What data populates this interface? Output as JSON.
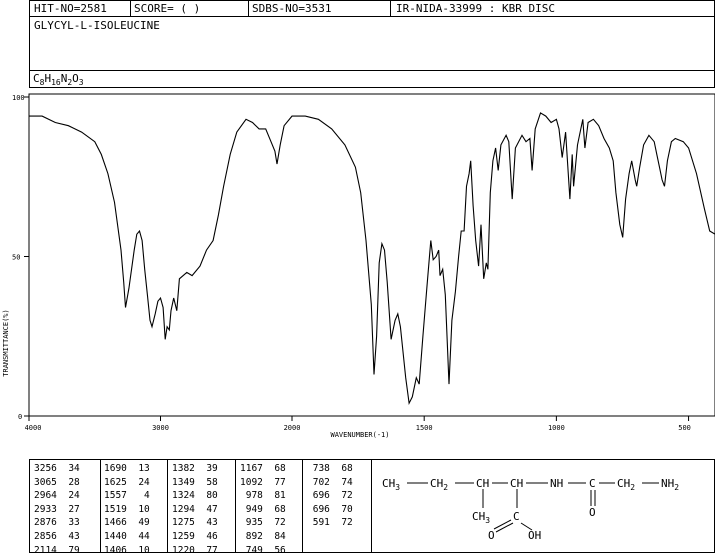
{
  "header": {
    "hit_no": "HIT-NO=2581",
    "score": "SCORE=  (   )",
    "sdbs_no": "SDBS-NO=3531",
    "ir_info": "IR-NIDA-33999 : KBR DISC"
  },
  "compound_name": "GLYCYL-L-ISOLEUCINE",
  "formula": "C8H16N2O3",
  "chart_data": {
    "type": "line",
    "xlabel": "WAVENUMBER(-1)",
    "ylabel": "TRANSMITTANCE(%)",
    "x_ticks": [
      4000,
      3000,
      2000,
      1500,
      1000,
      500
    ],
    "y_ticks": [
      0,
      50,
      100
    ],
    "xlim": [
      4000,
      400
    ],
    "ylim": [
      0,
      100
    ],
    "series": [
      {
        "points": [
          [
            4000,
            94
          ],
          [
            3900,
            94
          ],
          [
            3800,
            92
          ],
          [
            3700,
            91
          ],
          [
            3600,
            89
          ],
          [
            3500,
            86
          ],
          [
            3450,
            82
          ],
          [
            3400,
            76
          ],
          [
            3350,
            67
          ],
          [
            3300,
            52
          ],
          [
            3280,
            42
          ],
          [
            3266,
            34
          ],
          [
            3240,
            40
          ],
          [
            3200,
            52
          ],
          [
            3180,
            57
          ],
          [
            3160,
            58
          ],
          [
            3140,
            55
          ],
          [
            3120,
            46
          ],
          [
            3100,
            38
          ],
          [
            3080,
            30
          ],
          [
            3065,
            28
          ],
          [
            3040,
            32
          ],
          [
            3020,
            36
          ],
          [
            3000,
            37
          ],
          [
            2980,
            34
          ],
          [
            2964,
            24
          ],
          [
            2950,
            28
          ],
          [
            2933,
            27
          ],
          [
            2920,
            33
          ],
          [
            2900,
            37
          ],
          [
            2876,
            33
          ],
          [
            2856,
            43
          ],
          [
            2800,
            45
          ],
          [
            2760,
            44
          ],
          [
            2700,
            47
          ],
          [
            2650,
            52
          ],
          [
            2600,
            55
          ],
          [
            2560,
            63
          ],
          [
            2520,
            72
          ],
          [
            2470,
            82
          ],
          [
            2420,
            89
          ],
          [
            2350,
            93
          ],
          [
            2300,
            92
          ],
          [
            2250,
            90
          ],
          [
            2200,
            90
          ],
          [
            2160,
            86
          ],
          [
            2130,
            83
          ],
          [
            2114,
            79
          ],
          [
            2090,
            85
          ],
          [
            2060,
            91
          ],
          [
            2000,
            94
          ],
          [
            1950,
            94
          ],
          [
            1900,
            93
          ],
          [
            1850,
            90
          ],
          [
            1800,
            85
          ],
          [
            1760,
            78
          ],
          [
            1740,
            70
          ],
          [
            1720,
            55
          ],
          [
            1700,
            35
          ],
          [
            1690,
            13
          ],
          [
            1680,
            25
          ],
          [
            1670,
            48
          ],
          [
            1660,
            54
          ],
          [
            1650,
            52
          ],
          [
            1640,
            42
          ],
          [
            1625,
            24
          ],
          [
            1610,
            30
          ],
          [
            1600,
            32
          ],
          [
            1590,
            28
          ],
          [
            1570,
            12
          ],
          [
            1557,
            4
          ],
          [
            1545,
            6
          ],
          [
            1530,
            12
          ],
          [
            1519,
            10
          ],
          [
            1505,
            25
          ],
          [
            1490,
            40
          ],
          [
            1475,
            55
          ],
          [
            1466,
            49
          ],
          [
            1455,
            50
          ],
          [
            1445,
            52
          ],
          [
            1440,
            44
          ],
          [
            1430,
            46
          ],
          [
            1420,
            38
          ],
          [
            1406,
            10
          ],
          [
            1395,
            30
          ],
          [
            1382,
            39
          ],
          [
            1370,
            50
          ],
          [
            1360,
            58
          ],
          [
            1349,
            58
          ],
          [
            1340,
            72
          ],
          [
            1330,
            76
          ],
          [
            1324,
            80
          ],
          [
            1315,
            66
          ],
          [
            1305,
            55
          ],
          [
            1294,
            47
          ],
          [
            1285,
            60
          ],
          [
            1275,
            43
          ],
          [
            1265,
            48
          ],
          [
            1259,
            46
          ],
          [
            1250,
            70
          ],
          [
            1240,
            80
          ],
          [
            1230,
            84
          ],
          [
            1220,
            77
          ],
          [
            1210,
            85
          ],
          [
            1190,
            88
          ],
          [
            1180,
            86
          ],
          [
            1167,
            68
          ],
          [
            1155,
            84
          ],
          [
            1130,
            88
          ],
          [
            1115,
            86
          ],
          [
            1100,
            87
          ],
          [
            1092,
            77
          ],
          [
            1080,
            90
          ],
          [
            1060,
            95
          ],
          [
            1040,
            94
          ],
          [
            1020,
            92
          ],
          [
            1000,
            93
          ],
          [
            990,
            90
          ],
          [
            978,
            81
          ],
          [
            965,
            89
          ],
          [
            949,
            68
          ],
          [
            940,
            82
          ],
          [
            935,
            72
          ],
          [
            920,
            85
          ],
          [
            900,
            93
          ],
          [
            892,
            84
          ],
          [
            880,
            92
          ],
          [
            860,
            93
          ],
          [
            840,
            91
          ],
          [
            820,
            87
          ],
          [
            800,
            84
          ],
          [
            785,
            80
          ],
          [
            775,
            70
          ],
          [
            760,
            60
          ],
          [
            749,
            56
          ],
          [
            738,
            68
          ],
          [
            725,
            76
          ],
          [
            715,
            80
          ],
          [
            702,
            74
          ],
          [
            696,
            72
          ],
          [
            685,
            78
          ],
          [
            670,
            85
          ],
          [
            650,
            88
          ],
          [
            630,
            86
          ],
          [
            620,
            82
          ],
          [
            610,
            78
          ],
          [
            600,
            74
          ],
          [
            591,
            72
          ],
          [
            580,
            80
          ],
          [
            565,
            86
          ],
          [
            550,
            87
          ],
          [
            520,
            86
          ],
          [
            500,
            84
          ],
          [
            470,
            76
          ],
          [
            440,
            65
          ],
          [
            420,
            58
          ],
          [
            400,
            57
          ]
        ]
      }
    ],
    "peak_table": [
      [
        [
          "3256",
          "34"
        ],
        [
          "3065",
          "28"
        ],
        [
          "2964",
          "24"
        ],
        [
          "2933",
          "27"
        ],
        [
          "2876",
          "33"
        ],
        [
          "2856",
          "43"
        ],
        [
          "2114",
          "79"
        ]
      ],
      [
        [
          "1690",
          "13"
        ],
        [
          "1625",
          "24"
        ],
        [
          "1557",
          "4"
        ],
        [
          "1519",
          "10"
        ],
        [
          "1466",
          "49"
        ],
        [
          "1440",
          "44"
        ],
        [
          "1406",
          "10"
        ]
      ],
      [
        [
          "1382",
          "39"
        ],
        [
          "1349",
          "58"
        ],
        [
          "1324",
          "80"
        ],
        [
          "1294",
          "47"
        ],
        [
          "1275",
          "43"
        ],
        [
          "1259",
          "46"
        ],
        [
          "1220",
          "77"
        ]
      ],
      [
        [
          "1167",
          "68"
        ],
        [
          "1092",
          "77"
        ],
        [
          "978",
          "81"
        ],
        [
          "949",
          "68"
        ],
        [
          "935",
          "72"
        ],
        [
          "892",
          "84"
        ],
        [
          "749",
          "56"
        ]
      ],
      [
        [
          "738",
          "68"
        ],
        [
          "702",
          "74"
        ],
        [
          "696",
          "72"
        ],
        [
          "696",
          "70"
        ],
        [
          "591",
          "72"
        ]
      ]
    ]
  },
  "structure": {
    "ch3": "CH3",
    "ch2": "CH2",
    "ch_a": "CH",
    "ch_b": "CH",
    "nh": "NH",
    "c_amide": "C",
    "ch2_b": "CH2",
    "nh2": "NH2",
    "ch3_branch": "CH3",
    "c_acid": "C",
    "o_amide": "O",
    "o_acid": "O",
    "oh": "OH"
  }
}
